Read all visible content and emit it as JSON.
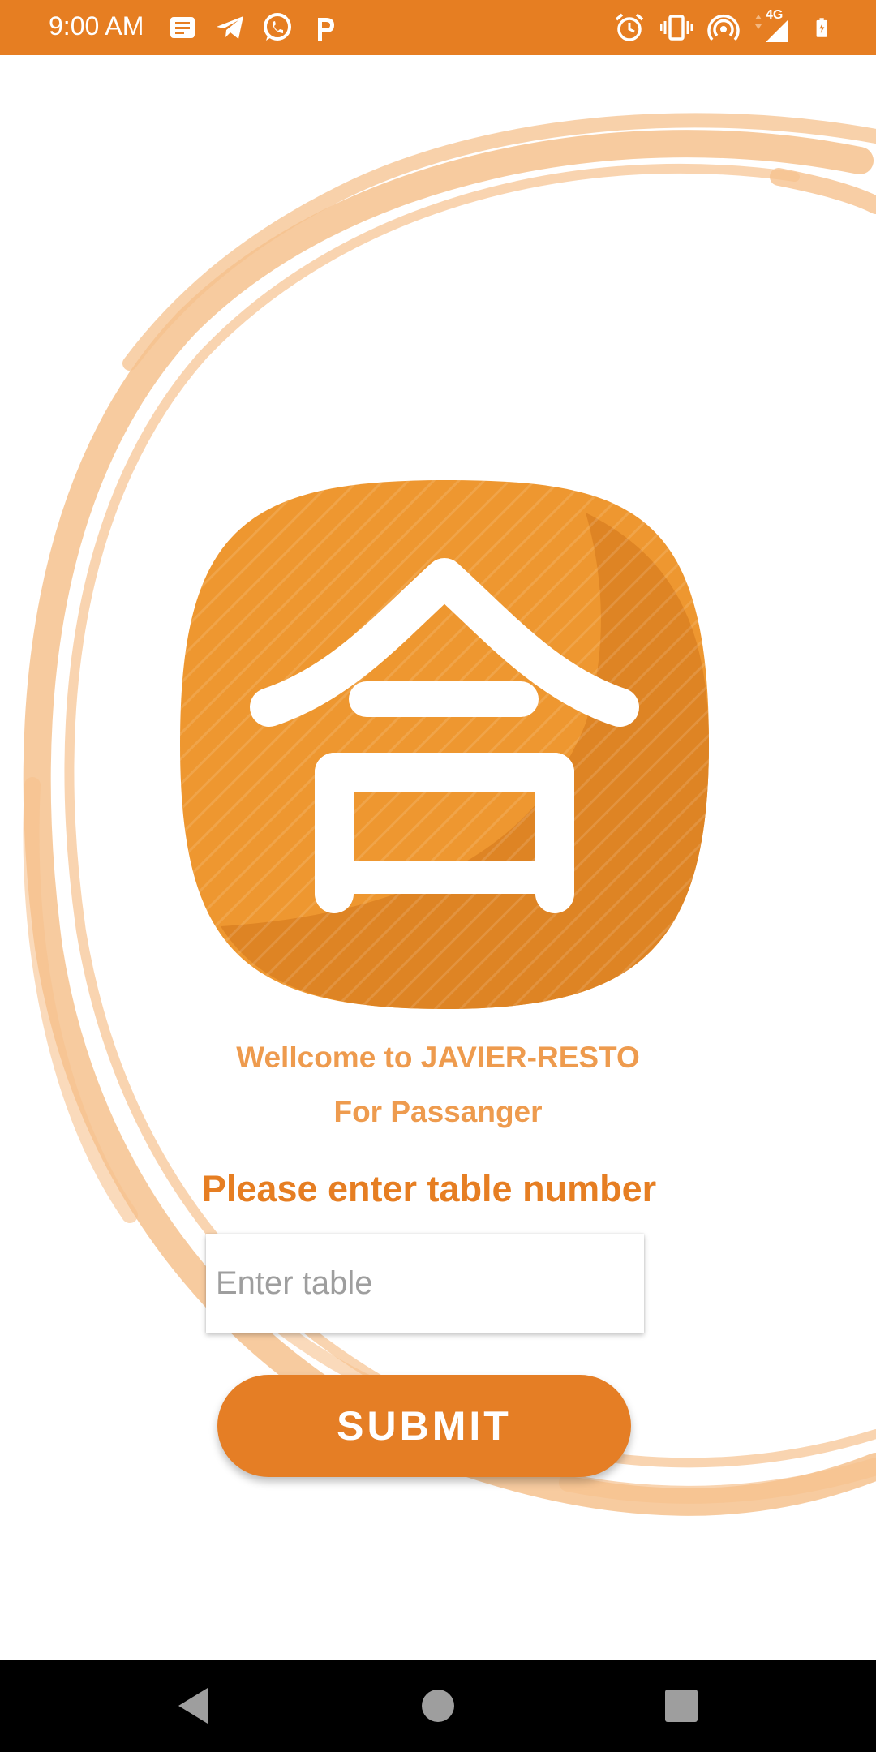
{
  "status_bar": {
    "time": "9:00 AM",
    "network_label": "4G",
    "background_color": "#E67E22",
    "left_icons": [
      "notification-icon",
      "telegram-icon",
      "whatsapp-icon",
      "parking-icon"
    ],
    "right_icons": [
      "alarm-icon",
      "vibrate-icon",
      "hotspot-icon",
      "signal-icon",
      "battery-icon"
    ]
  },
  "main": {
    "welcome_line_1": "Wellcome to JAVIER-RESTO",
    "welcome_line_2": "For Passanger",
    "prompt": "Please enter table number",
    "table_input": {
      "value": "",
      "placeholder": "Enter table"
    },
    "submit_label": "SUBMIT"
  },
  "nav_bar": {
    "icons": [
      "back-icon",
      "home-icon",
      "recents-icon"
    ]
  },
  "colors": {
    "accent": "#E67E22",
    "welcome_text": "#EE9B4E",
    "brush": "#F6C28E"
  }
}
